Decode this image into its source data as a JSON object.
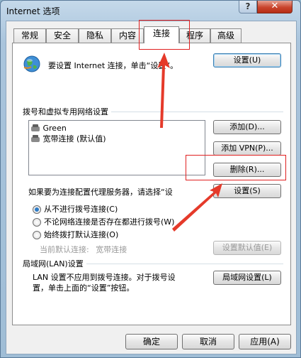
{
  "window": {
    "title": "Internet 选项",
    "help_label": "?",
    "close_label": "✕"
  },
  "tabs": [
    "常规",
    "安全",
    "隐私",
    "内容",
    "连接",
    "程序",
    "高级"
  ],
  "active_tab": "连接",
  "setup": {
    "text": "要设置 Internet 连接，单击“设置”。",
    "button": "设置(U)"
  },
  "dialup": {
    "section_title": "拨号和虚拟专用网络设置",
    "items": [
      "Green",
      "宽带连接 (默认值)"
    ],
    "add_button": "添加(D)...",
    "add_vpn_button": "添加 VPN(P)...",
    "remove_button": "删除(R)...",
    "proxy_text": "如果要为连接配置代理服务器，请选择“设",
    "settings_button": "设置(S)",
    "options": [
      "从不进行拨号连接(C)",
      "不论网络连接是否存在都进行拨号(W)",
      "始终拨打默认连接(O)"
    ],
    "selected_option": 0,
    "current_default_label": "当前默认连接:",
    "current_default_value": "宽带连接",
    "set_default_button": "设置默认值(E)"
  },
  "lan": {
    "section_title": "局域网(LAN)设置",
    "text_line1": "LAN 设置不应用到拨号连接。对于拨号设",
    "text_line2": "置，单击上面的“设置”按钮。",
    "button": "局域网设置(L)"
  },
  "footer": {
    "ok": "确定",
    "cancel": "取消",
    "apply": "应用(A)"
  },
  "colors": {
    "highlight_red": "#e02020",
    "arrow_red": "#e53a2a"
  }
}
